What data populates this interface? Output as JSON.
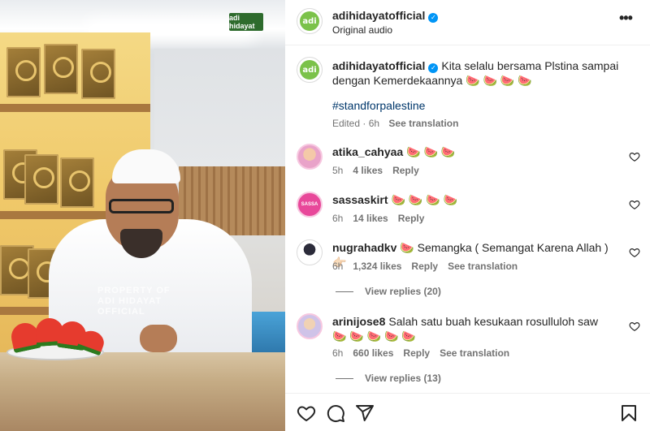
{
  "post": {
    "author": "adihidayatofficial",
    "audio": "Original audio",
    "logo_text": "adi",
    "caption": {
      "text": "Kita selalu bersama Plstina sampai dengan Kemerdekaannya 🍉 🍉 🍉 🍉",
      "hashtag": "#standforpalestine",
      "edited": "Edited · 6h",
      "see_translation": "See translation"
    }
  },
  "video": {
    "watermark": "PROPERTY OF ADI HIDAYAT OFFICIAL",
    "corner_logo": "adi hidayat"
  },
  "comments": [
    {
      "user": "atika_cahyaa",
      "text": "🍉 🍉 🍉",
      "time": "5h",
      "likes": "4 likes",
      "reply": "Reply"
    },
    {
      "user": "sassaskirt",
      "text": "🍉 🍉 🍉 🍉",
      "time": "6h",
      "likes": "14 likes",
      "reply": "Reply"
    },
    {
      "user": "nugrahadkv",
      "text": "🍉  Semangka ( Semangat Karena Allah ) 👉🏻",
      "time": "6h",
      "likes": "1,324 likes",
      "reply": "Reply",
      "see_translation": "See translation",
      "view_replies": "View replies (20)"
    },
    {
      "user": "arinijose8",
      "text": "Salah satu buah kesukaan rosulluloh saw 🍉 🍉 🍉 🍉 🍉",
      "time": "6h",
      "likes": "660 likes",
      "reply": "Reply",
      "see_translation": "See translation",
      "view_replies": "View replies (13)"
    }
  ],
  "actions": {
    "like_icon": "heart-icon",
    "comment_icon": "comment-icon",
    "share_icon": "share-icon",
    "save_icon": "bookmark-icon"
  },
  "colors": {
    "link": "#00376b",
    "verified": "#0095f6",
    "muted": "#737373",
    "text": "#262626"
  }
}
